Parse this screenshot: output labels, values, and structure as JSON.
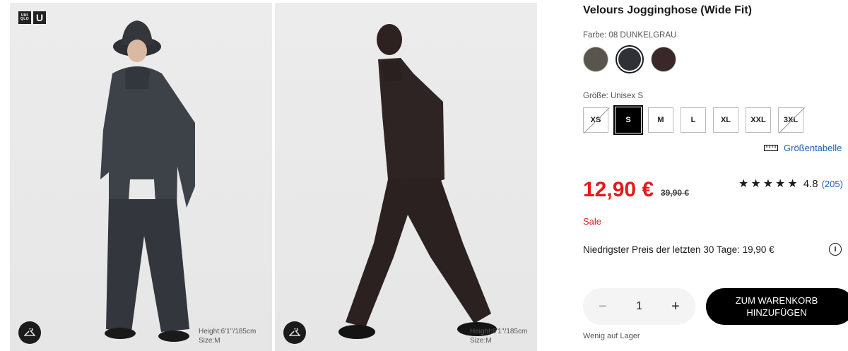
{
  "gallery": {
    "logo": {
      "top": "UNI QLO",
      "right": "U"
    },
    "photos": [
      {
        "model_height": "Height:6'1''/185cm",
        "model_size": "Size:M"
      },
      {
        "model_height": "Height:6'1''/185cm",
        "model_size": "Size:M"
      }
    ]
  },
  "product": {
    "title": "Velours Jogginghose (Wide Fit)",
    "color_label": "Farbe: 08 DUNKELGRAU",
    "colors": [
      {
        "name": "brown-grey",
        "hex": "#5a554c",
        "selected": false
      },
      {
        "name": "08 DUNKELGRAU",
        "hex": "#2f3136",
        "selected": true
      },
      {
        "name": "dark-brown",
        "hex": "#3a2727",
        "selected": false
      }
    ],
    "size_label": "Größe: Unisex S",
    "sizes": [
      {
        "label": "XS",
        "state": "unavailable"
      },
      {
        "label": "S",
        "state": "selected"
      },
      {
        "label": "M",
        "state": "available"
      },
      {
        "label": "L",
        "state": "available"
      },
      {
        "label": "XL",
        "state": "available"
      },
      {
        "label": "XXL",
        "state": "available"
      },
      {
        "label": "3XL",
        "state": "unavailable"
      }
    ],
    "size_chart_label": "Größentabelle",
    "price": "12,90 €",
    "old_price": "39,90 €",
    "rating_stars": "★★★★★",
    "rating_value": "4.8",
    "rating_count": "(205)",
    "sale_label": "Sale",
    "lowest_price_text": "Niedrigster Preis der letzten 30 Tage: 19,90 €",
    "info_icon": "i",
    "quantity": "1",
    "minus_label": "−",
    "plus_label": "+",
    "cart_button_line1": "ZUM WARENKORB",
    "cart_button_line2": "HINZUFÜGEN",
    "stock_text": "Wenig auf Lager"
  },
  "colors": {
    "sale_red": "#e21b1b",
    "link_blue": "#1f5fb3",
    "black": "#000000"
  }
}
